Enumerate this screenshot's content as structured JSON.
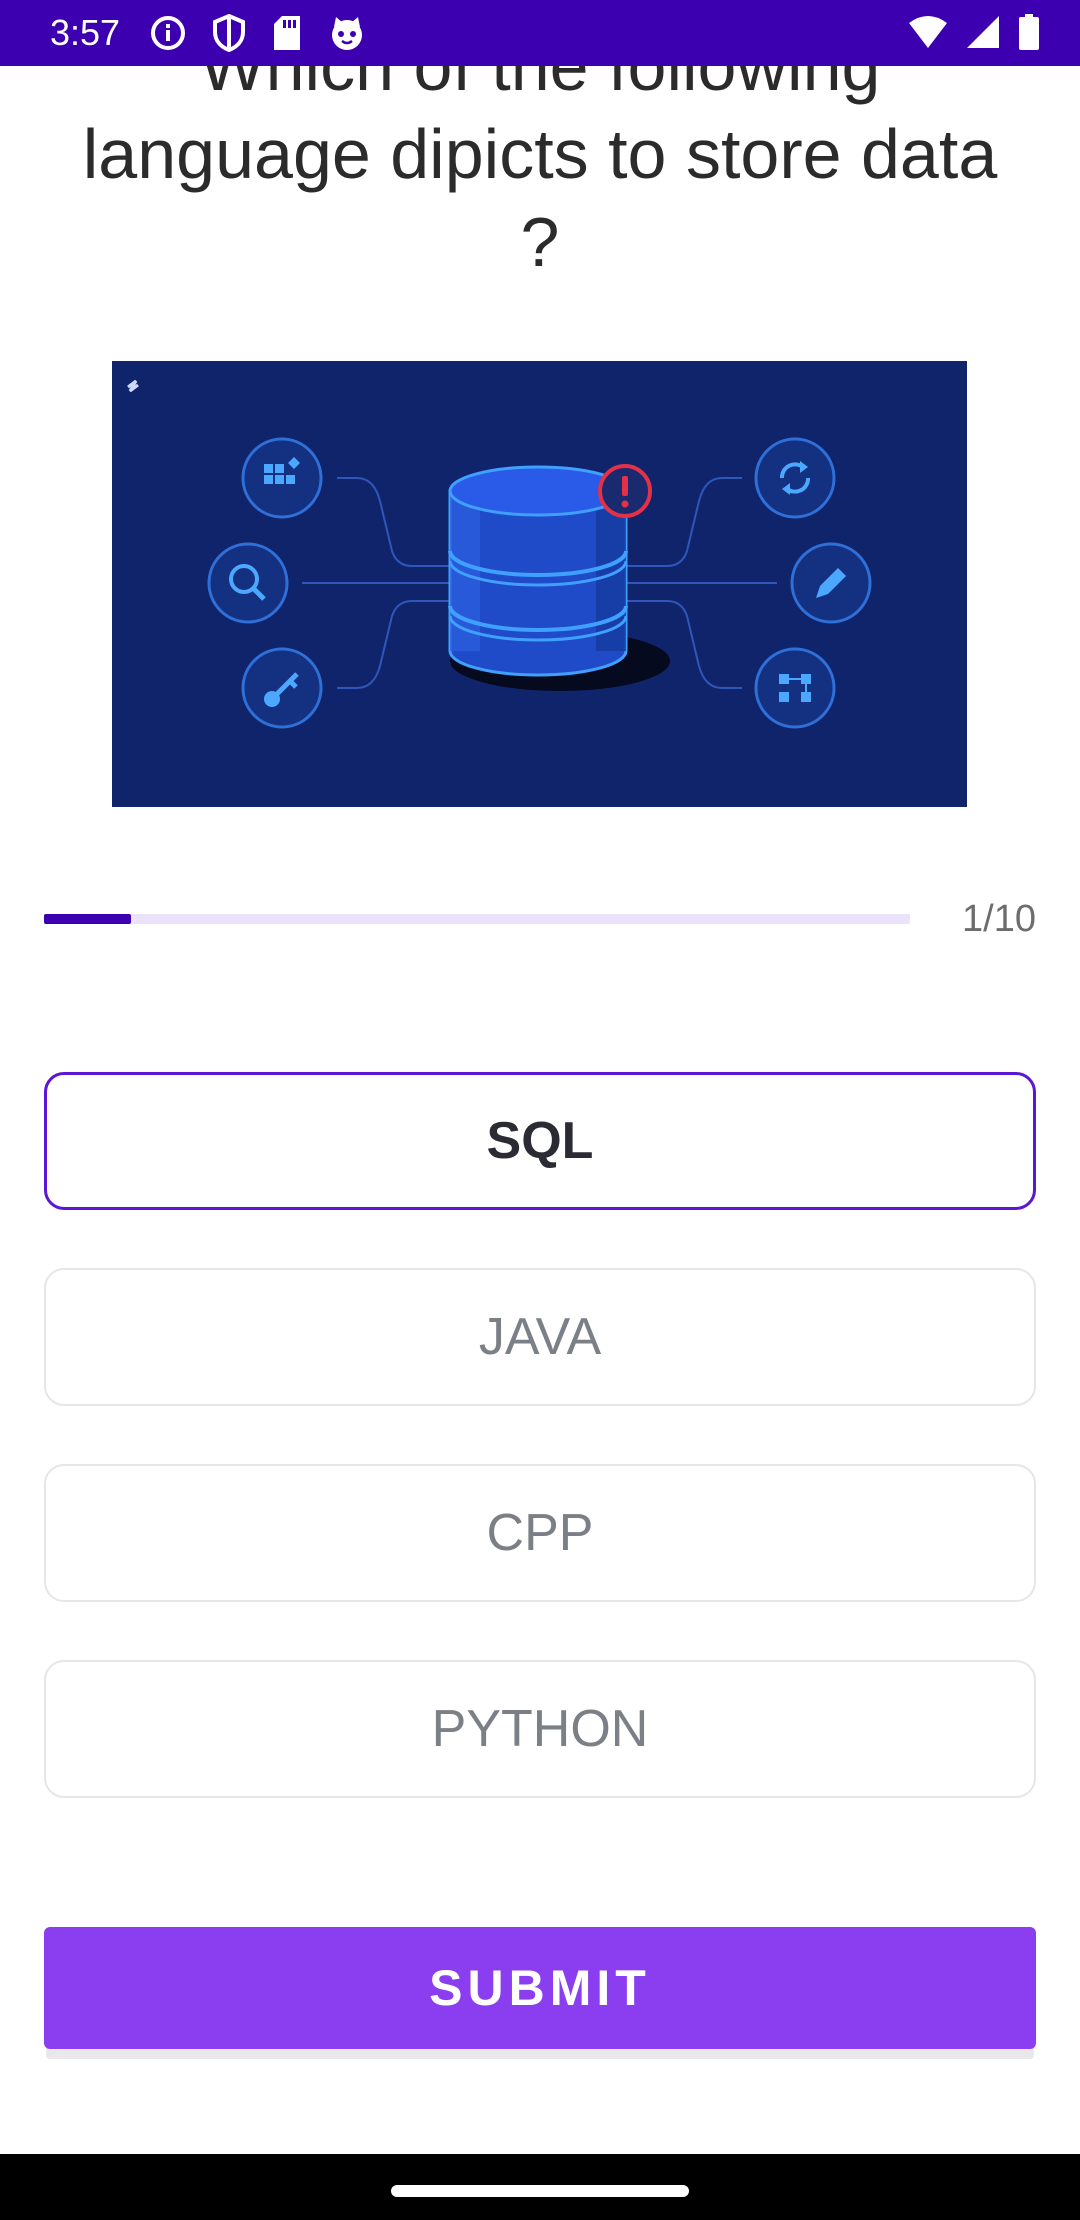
{
  "status_bar": {
    "time": "3:57",
    "left_icons": [
      "info-icon",
      "shield-icon",
      "sd-card-icon",
      "cat-icon"
    ],
    "right_icons": [
      "wifi-icon",
      "signal-icon",
      "battery-icon"
    ],
    "background": "#3d00b0"
  },
  "question": {
    "text": "Which of the following language dipicts to store data ?"
  },
  "illustration": {
    "icons_left": [
      "grid-icon",
      "search-icon",
      "key-icon"
    ],
    "icons_right": [
      "refresh-icon",
      "edit-icon",
      "structure-icon"
    ],
    "center": "database-icon",
    "alert": "alert-icon",
    "background": "#10246b"
  },
  "progress": {
    "current": 1,
    "total": 10,
    "fraction": 0.1,
    "label": "1/10",
    "fill_color": "#3d00b0",
    "track_color": "#ebe2fb"
  },
  "options": [
    {
      "label": "SQL",
      "selected": true
    },
    {
      "label": "JAVA",
      "selected": false
    },
    {
      "label": "CPP",
      "selected": false
    },
    {
      "label": "PYTHON",
      "selected": false
    }
  ],
  "submit": {
    "label": "SUBMIT",
    "color": "#8a3ef0"
  }
}
